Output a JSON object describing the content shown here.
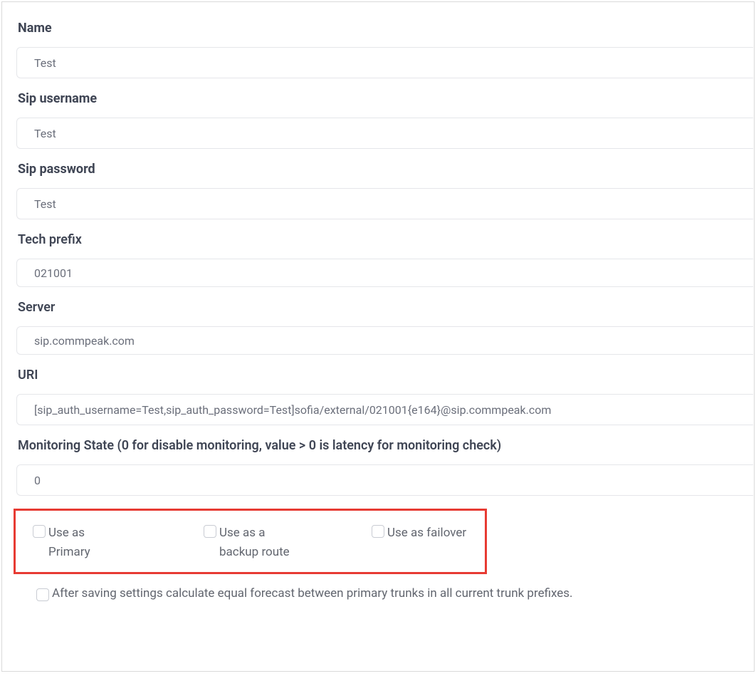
{
  "fields": {
    "name": {
      "label": "Name",
      "value": "Test"
    },
    "sip_username": {
      "label": "Sip username",
      "value": "Test"
    },
    "sip_password": {
      "label": "Sip password",
      "value": "Test"
    },
    "tech_prefix": {
      "label": "Tech prefix",
      "value": "021001"
    },
    "server": {
      "label": "Server",
      "value": "sip.commpeak.com"
    },
    "uri": {
      "label": "URI",
      "value": "[sip_auth_username=Test,sip_auth_password=Test]sofia/external/021001{e164}@sip.commpeak.com"
    },
    "monitoring_state": {
      "label": "Monitoring State (0 for disable monitoring, value > 0 is latency for monitoring check)",
      "value": "0"
    }
  },
  "checkboxes": {
    "primary": "Use as Primary",
    "backup": "Use as a backup route",
    "failover": "Use as failover",
    "forecast": "After saving settings calculate equal forecast between primary trunks in all current trunk prefixes."
  }
}
